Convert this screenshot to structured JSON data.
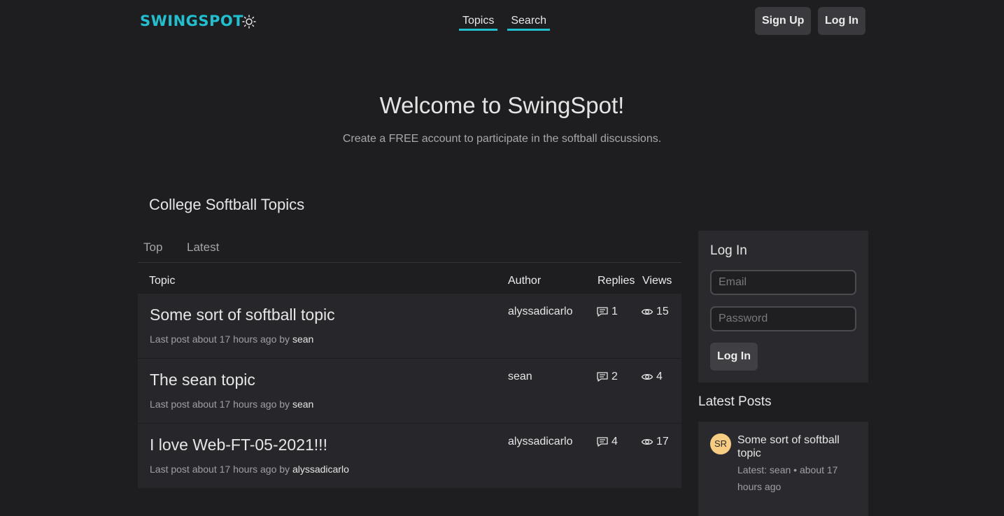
{
  "header": {
    "logo": "SWINGSPOT",
    "nav": [
      {
        "label": "Topics"
      },
      {
        "label": "Search"
      }
    ],
    "signup_label": "Sign Up",
    "login_label": "Log In",
    "theme_icon": "sun-icon"
  },
  "hero": {
    "title": "Welcome to SwingSpot!",
    "subtitle": "Create a FREE account to participate in the softball discussions."
  },
  "topics": {
    "section_title": "College Softball Topics",
    "tabs": [
      "Top",
      "Latest"
    ],
    "columns": [
      "Topic",
      "Author",
      "Replies",
      "Views"
    ],
    "rows": [
      {
        "title": "Some sort of softball topic",
        "meta_prefix": "Last post about 17 hours ago by",
        "last_user": "sean",
        "author": "alyssadicarlo",
        "replies": "1",
        "views": "15"
      },
      {
        "title": "The sean topic",
        "meta_prefix": "Last post about 17 hours ago by",
        "last_user": "sean",
        "author": "sean",
        "replies": "2",
        "views": "4"
      },
      {
        "title": "I love Web-FT-05-2021!!!",
        "meta_prefix": "Last post about 17 hours ago by",
        "last_user": "alyssadicarlo",
        "author": "alyssadicarlo",
        "replies": "4",
        "views": "17"
      }
    ]
  },
  "login": {
    "title": "Log In",
    "email_placeholder": "Email",
    "password_placeholder": "Password",
    "button_label": "Log In"
  },
  "latest_posts": {
    "title": "Latest Posts",
    "items": [
      {
        "initials": "SR",
        "title": "Some sort of softball topic",
        "meta": "Latest: sean • about 17 hours ago"
      }
    ]
  },
  "colors": {
    "accent": "#1fc1d0",
    "background": "#1e1e21",
    "card": "#27272b",
    "avatar": "#f7cd83"
  }
}
